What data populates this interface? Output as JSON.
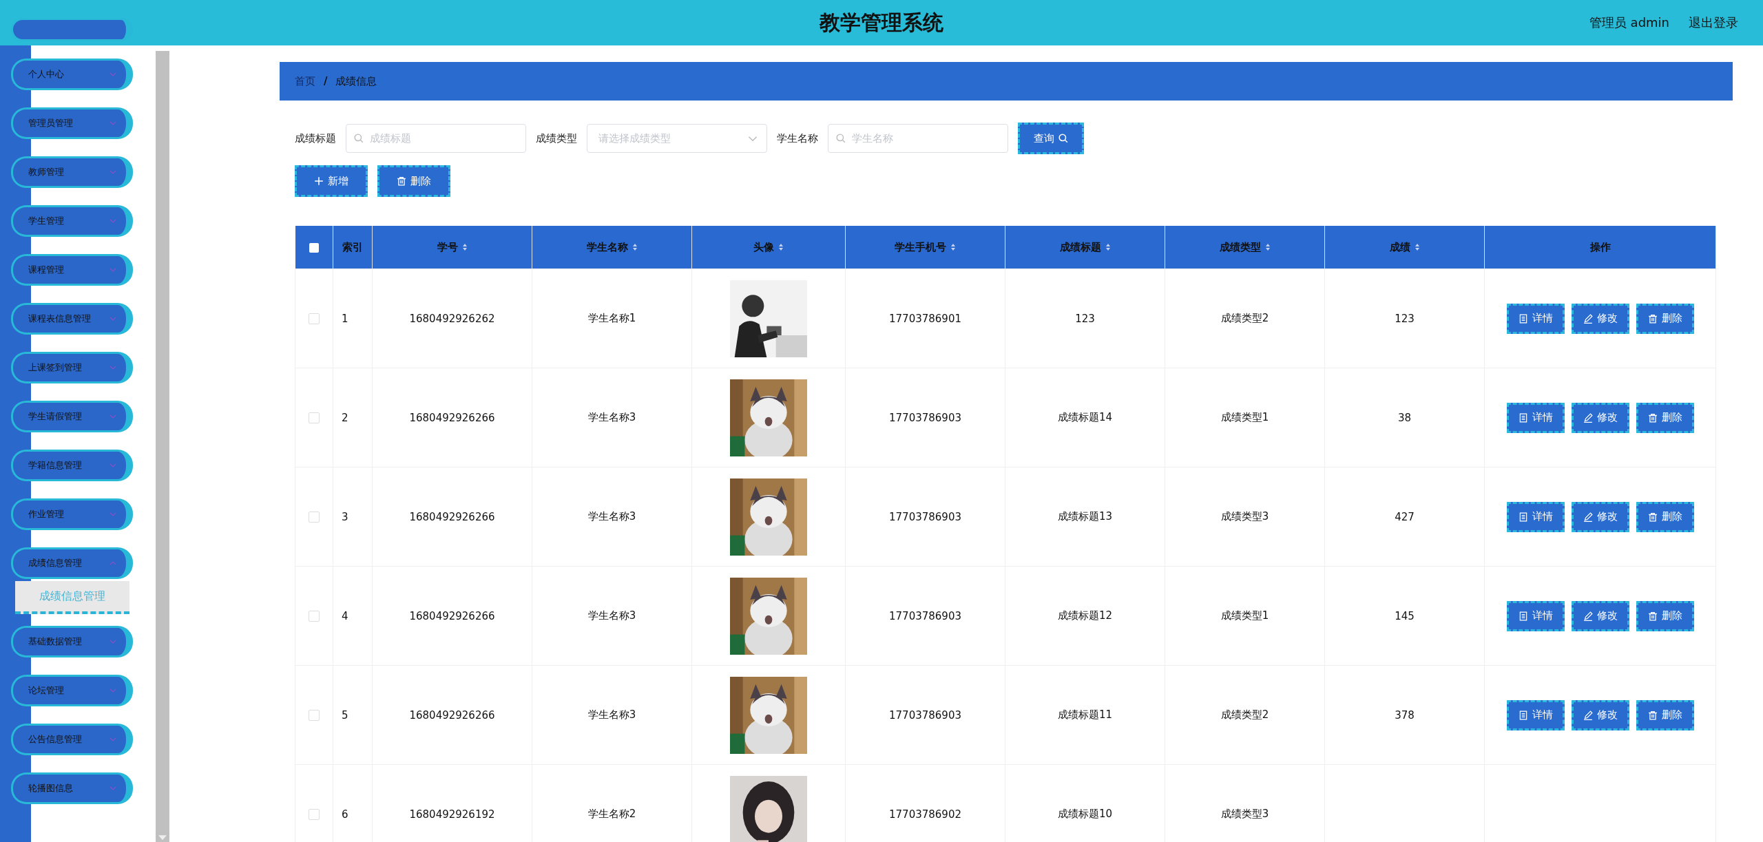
{
  "header": {
    "title": "教学管理系统",
    "user": "管理员 admin",
    "logout": "退出登录"
  },
  "sidebar": {
    "items": [
      {
        "label": "个人中心",
        "expanded": false
      },
      {
        "label": "管理员管理",
        "expanded": false
      },
      {
        "label": "教师管理",
        "expanded": false
      },
      {
        "label": "学生管理",
        "expanded": false
      },
      {
        "label": "课程管理",
        "expanded": false
      },
      {
        "label": "课程表信息管理",
        "expanded": false
      },
      {
        "label": "上课签到管理",
        "expanded": false
      },
      {
        "label": "学生请假管理",
        "expanded": false
      },
      {
        "label": "学籍信息管理",
        "expanded": false
      },
      {
        "label": "作业管理",
        "expanded": false
      },
      {
        "label": "成绩信息管理",
        "expanded": true,
        "children": [
          {
            "label": "成绩信息管理",
            "selected": true
          }
        ]
      },
      {
        "label": "基础数据管理",
        "expanded": false
      },
      {
        "label": "论坛管理",
        "expanded": false
      },
      {
        "label": "公告信息管理",
        "expanded": false
      },
      {
        "label": "轮播图信息",
        "expanded": false
      }
    ]
  },
  "breadcrumb": {
    "items": [
      "首页",
      "成绩信息"
    ],
    "separator": "/"
  },
  "filters": [
    {
      "kind": "text",
      "label": "成绩标题",
      "placeholder": "成绩标题"
    },
    {
      "kind": "select",
      "label": "成绩类型",
      "placeholder": "请选择成绩类型"
    },
    {
      "kind": "text",
      "label": "学生名称",
      "placeholder": "学生名称"
    }
  ],
  "search_button": "查询",
  "actions": [
    {
      "kind": "add",
      "label": "新增"
    },
    {
      "kind": "delete",
      "label": "删除"
    }
  ],
  "table": {
    "all_checked": false,
    "columns": [
      {
        "label": "索引",
        "sortable": false
      },
      {
        "label": "学号",
        "sortable": true
      },
      {
        "label": "学生名称",
        "sortable": true
      },
      {
        "label": "头像",
        "sortable": true
      },
      {
        "label": "学生手机号",
        "sortable": true
      },
      {
        "label": "成绩标题",
        "sortable": true
      },
      {
        "label": "成绩类型",
        "sortable": true
      },
      {
        "label": "成绩",
        "sortable": true
      },
      {
        "label": "操作",
        "sortable": false
      }
    ],
    "rows": [
      {
        "checked": false,
        "index": "1",
        "student_id": "1680492926262",
        "name": "学生名称1",
        "phone": "17703786901",
        "title": "123",
        "type": "成绩类型2",
        "score": "123",
        "actions": [
          {
            "kind": "detail",
            "label": "详情"
          },
          {
            "kind": "edit",
            "label": "修改"
          },
          {
            "kind": "delete",
            "label": "删除"
          }
        ]
      },
      {
        "checked": false,
        "index": "2",
        "student_id": "1680492926266",
        "name": "学生名称3",
        "phone": "17703786903",
        "title": "成绩标题14",
        "type": "成绩类型1",
        "score": "38",
        "actions": [
          {
            "kind": "detail",
            "label": "详情"
          },
          {
            "kind": "edit",
            "label": "修改"
          },
          {
            "kind": "delete",
            "label": "删除"
          }
        ]
      },
      {
        "checked": false,
        "index": "3",
        "student_id": "1680492926266",
        "name": "学生名称3",
        "phone": "17703786903",
        "title": "成绩标题13",
        "type": "成绩类型3",
        "score": "427",
        "actions": [
          {
            "kind": "detail",
            "label": "详情"
          },
          {
            "kind": "edit",
            "label": "修改"
          },
          {
            "kind": "delete",
            "label": "删除"
          }
        ]
      },
      {
        "checked": false,
        "index": "4",
        "student_id": "1680492926266",
        "name": "学生名称3",
        "phone": "17703786903",
        "title": "成绩标题12",
        "type": "成绩类型1",
        "score": "145",
        "actions": [
          {
            "kind": "detail",
            "label": "详情"
          },
          {
            "kind": "edit",
            "label": "修改"
          },
          {
            "kind": "delete",
            "label": "删除"
          }
        ]
      },
      {
        "checked": false,
        "index": "5",
        "student_id": "1680492926266",
        "name": "学生名称3",
        "phone": "17703786903",
        "title": "成绩标题11",
        "type": "成绩类型2",
        "score": "378",
        "actions": [
          {
            "kind": "detail",
            "label": "详情"
          },
          {
            "kind": "edit",
            "label": "修改"
          },
          {
            "kind": "delete",
            "label": "删除"
          }
        ]
      },
      {
        "checked": false,
        "index": "6",
        "student_id": "1680492926192",
        "name": "学生名称2",
        "phone": "17703786902",
        "title": "成绩标题10",
        "type": "成绩类型3"
      }
    ]
  }
}
